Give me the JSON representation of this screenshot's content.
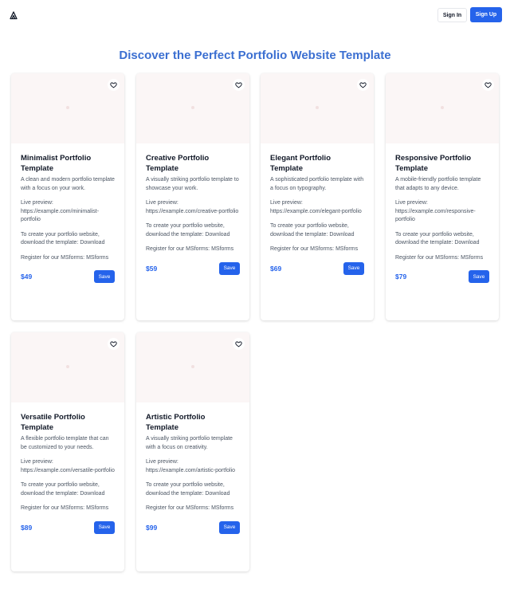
{
  "header": {
    "logo_icon": "triangle-logo-icon",
    "signin_label": "Sign In",
    "signup_label": "Sign Up"
  },
  "page_title": "Discover the Perfect Portfolio Website Template",
  "colors": {
    "accent": "#2563eb",
    "title": "#3b6fd1",
    "image_bg": "#fbf6f6"
  },
  "cards": [
    {
      "title": "Minimalist Portfolio Template",
      "description": "A clean and modern portfolio template with a focus on your work.",
      "preview": "Live preview: https://example.com/minimalist-portfolio",
      "download": "To create your portfolio website, download the template: Download",
      "register": "Register for our MSforms: MSforms",
      "price": "$49",
      "save_label": "Save"
    },
    {
      "title": "Creative Portfolio Template",
      "description": "A visually striking portfolio template to showcase your work.",
      "preview": "Live preview: https://example.com/creative-portfolio",
      "download": "To create your portfolio website, download the template: Download",
      "register": "Register for our MSforms: MSforms",
      "price": "$59",
      "save_label": "Save"
    },
    {
      "title": "Elegant Portfolio Template",
      "description": "A sophisticated portfolio template with a focus on typography.",
      "preview": "Live preview: https://example.com/elegant-portfolio",
      "download": "To create your portfolio website, download the template: Download",
      "register": "Register for our MSforms: MSforms",
      "price": "$69",
      "save_label": "Save"
    },
    {
      "title": "Responsive Portfolio Template",
      "description": "A mobile-friendly portfolio template that adapts to any device.",
      "preview": "Live preview: https://example.com/responsive-portfolio",
      "download": "To create your portfolio website, download the template: Download",
      "register": "Register for our MSforms: MSforms",
      "price": "$79",
      "save_label": "Save"
    },
    {
      "title": "Versatile Portfolio Template",
      "description": "A flexible portfolio template that can be customized to your needs.",
      "preview": "Live preview: https://example.com/versatile-portfolio",
      "download": "To create your portfolio website, download the template: Download",
      "register": "Register for our MSforms: MSforms",
      "price": "$89",
      "save_label": "Save"
    },
    {
      "title": "Artistic Portfolio Template",
      "description": "A visually striking portfolio template with a focus on creativity.",
      "preview": "Live preview: https://example.com/artistic-portfolio",
      "download": "To create your portfolio website, download the template: Download",
      "register": "Register for our MSforms: MSforms",
      "price": "$99",
      "save_label": "Save"
    }
  ]
}
